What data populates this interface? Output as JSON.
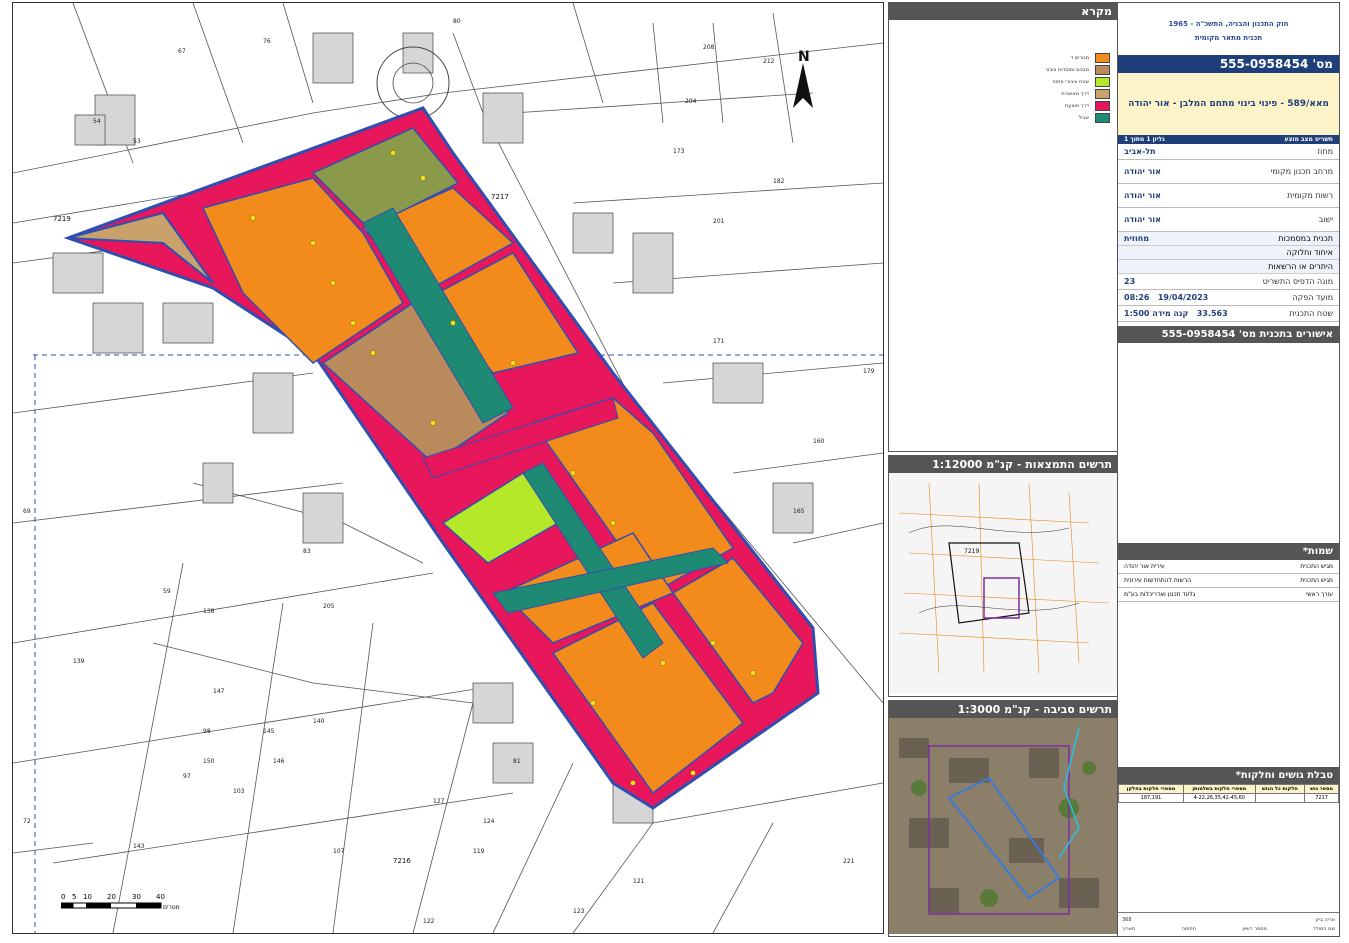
{
  "legend": {
    "title": "מקרא",
    "items": [
      {
        "label": "מגורים ד",
        "color": "#f28a1c"
      },
      {
        "label": "מבנים ומוסדות ציבור",
        "color": "#b98a5c"
      },
      {
        "label": "שטח ציבורי פתוח",
        "color": "#b6e82a"
      },
      {
        "label": "דרך מאושרת",
        "color": "#c9a26b"
      },
      {
        "label": "דרך מוצעת",
        "color": "#e8165b"
      },
      {
        "label": "שביל",
        "color": "#1e8a73"
      }
    ]
  },
  "insets": {
    "location": {
      "title": "תרשים התמצאות - קנ\"מ 1:12000",
      "label": "7219"
    },
    "surroundings": {
      "title": "תרשים סביבה - קנ\"מ 1:3000"
    }
  },
  "title_block": {
    "law": "חוק התכנון והבניה, התשכ\"ה - 1965",
    "plan_kind": "תכנית מתאר מקומית",
    "plan_number": "מס' 555-0958454",
    "plan_name": "מאא/589 - פינוי בינוי מתחם המלבן - אור יהודה",
    "sheet_status": "תשריט מצב מוצע",
    "sheet": "גליון 1 מתוך 1",
    "rows": [
      {
        "k": "מחוז",
        "v": "תל-אביב"
      },
      {
        "k": "מרחב תכנון מקומי",
        "v": "אור יהודה"
      },
      {
        "k": "רשות מקומית",
        "v": "אור יהודה"
      },
      {
        "k": "ישוב",
        "v": "אור יהודה"
      }
    ],
    "flags": [
      {
        "k": "תכנית במסמכות",
        "v": "מחוזית"
      },
      {
        "k": "איחוד וחלוקה",
        "v": ""
      },
      {
        "k": "היתרים או הרשאות",
        "v": ""
      }
    ],
    "counter_label": "מונה הדפיס התשריט",
    "counter": "23",
    "print_label": "מועד הפקה",
    "print_date": "19/04/2023",
    "print_time": "08:26",
    "area_label": "שטח התכנית",
    "area": "33.563",
    "scale_label": "קנה מידה",
    "scale": "1:500",
    "approvals": "אישורים בתכנית מס' 555-0958454",
    "names_title": "שמות*",
    "names": [
      {
        "role": "מגיש התכנית",
        "name": "עירית אור יהודה"
      },
      {
        "role": "מגיש התכנית",
        "name": "הרשות להתחדשות עירונית"
      },
      {
        "role": "עורך ראשי",
        "name": "גלעד תכנון ואדריכלות בע\"מ"
      }
    ],
    "parcels_title": "טבלת גושים וחלקות*",
    "parcel_headers": [
      "מספר גוש",
      "חלקות כל הגוש",
      "מספרי חלקות בשלמותן",
      "מספרי חלקות בחלקן"
    ],
    "parcels": [
      [
        "7217",
        "",
        "4-22,26,35,42-45,60",
        "187,191"
      ]
    ],
    "footer_surveyor": "אריה ביזן",
    "footer_license": "368",
    "footer_labels": [
      "שם המודד",
      "מספר רשיון",
      "חתימה",
      "תאריך"
    ]
  },
  "map": {
    "north": "N",
    "scale_ticks": [
      "0",
      "5",
      "10",
      "20",
      "30",
      "40"
    ],
    "scale_unit": "מטרים",
    "block_labels": [
      "7217",
      "7219",
      "7216"
    ],
    "parcel_numbers": [
      "76",
      "54",
      "53",
      "80",
      "208",
      "204",
      "212",
      "173",
      "182",
      "201",
      "171",
      "179",
      "165",
      "160",
      "139",
      "147",
      "145",
      "140",
      "138",
      "103",
      "97",
      "98",
      "150",
      "146",
      "143",
      "127",
      "124",
      "121",
      "122",
      "119",
      "123",
      "107",
      "72",
      "67",
      "59",
      "83",
      "69",
      "81",
      "205",
      "221"
    ]
  }
}
